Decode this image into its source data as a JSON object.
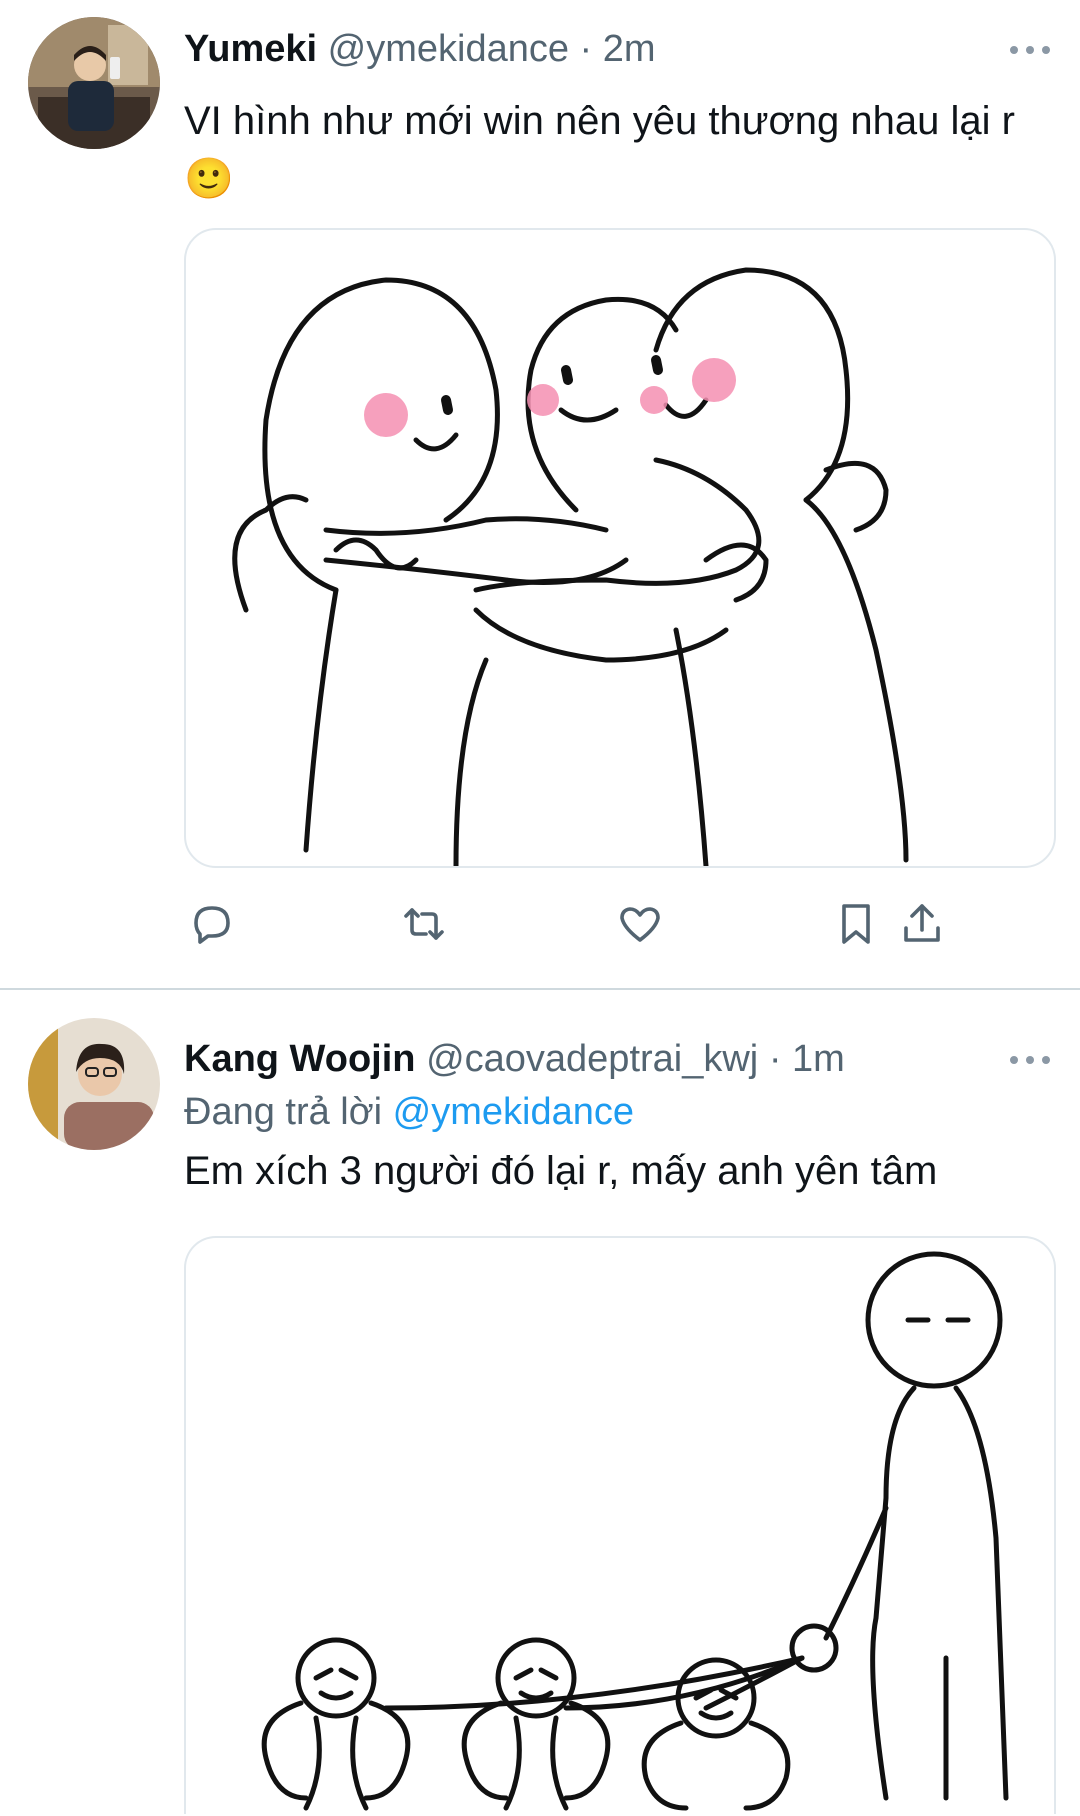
{
  "tweets": [
    {
      "name": "Yumeki",
      "handle": "@ymekidance",
      "time_sep": "·",
      "time": "2m",
      "text": "VI hình như mới win nên yêu thương nhau lại r 🙂",
      "avatar_icon": "user-avatar-photo",
      "media_alt_icon": "hugging-blobs-drawing",
      "actions": [
        "reply-icon",
        "retweet-icon",
        "like-icon",
        "bookmark-icon",
        "share-icon"
      ]
    },
    {
      "name": "Kang Woojin",
      "handle": "@caovadeptrai_kwj",
      "time_sep": "·",
      "time": "1m",
      "reply_prefix": "Đang trả lời",
      "reply_mention": "@ymekidance",
      "text": "Em xích 3 người đó lại r, mấy anh yên tâm",
      "avatar_icon": "user-avatar-photo",
      "media_alt_icon": "leashed-figures-drawing"
    }
  ],
  "colors": {
    "text_primary": "#0f1419",
    "text_secondary": "#536471",
    "accent": "#1d9bf0",
    "divider": "#cfd9de",
    "blush": "#f48fb1"
  }
}
